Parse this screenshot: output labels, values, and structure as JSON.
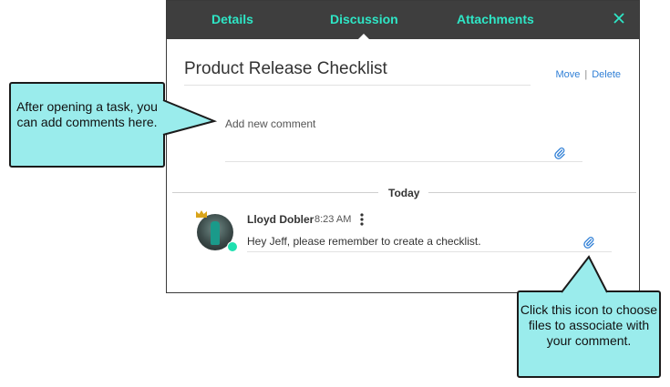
{
  "tabs": {
    "details": "Details",
    "discussion": "Discussion",
    "attachments": "Attachments"
  },
  "task": {
    "title": "Product Release Checklist",
    "move_label": "Move",
    "separator": "|",
    "delete_label": "Delete"
  },
  "new_comment": {
    "placeholder": "Add new comment"
  },
  "divider": {
    "label": "Today"
  },
  "comment": {
    "author": "Lloyd Dobler",
    "time": "8:23 AM",
    "text": "Hey Jeff, please remember to create a checklist."
  },
  "callouts": {
    "left_text": "After opening a task, you can add comments here.",
    "right_text": "Click this icon to choose files to associate with your comment."
  },
  "icons": {
    "close": "close-icon",
    "attachment": "paperclip-icon",
    "crown": "crown-icon",
    "menu": "kebab-icon"
  },
  "colors": {
    "tabbar_bg": "#3e3e3e",
    "tab_text": "#2ee6c6",
    "link": "#2f7fd6",
    "callout_bg": "#9aecec",
    "presence": "#1fe0b0"
  }
}
